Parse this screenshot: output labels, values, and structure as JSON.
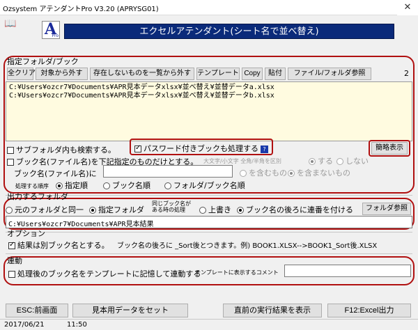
{
  "window": {
    "title": "Ozsystem アテンダントPro V3.20 (APRYSG01)",
    "close": "✕"
  },
  "logo": {
    "letter": "A",
    "sub": "Pro"
  },
  "banner": "エクセルアテンダント(シート名で並べ替え)",
  "folder_section": {
    "heading": "指定フォルダ/ブック",
    "toolbar": [
      "全クリア",
      "対象から外す",
      "存在しないものを一覧から外す",
      "テンプレート",
      "Copy",
      "貼付",
      "ファイル/フォルダ参照"
    ],
    "count": "2",
    "files": [
      "C:¥Users¥ozcr7¥Documents¥APR見本データxlsx¥並べ替え¥並替データa.xlsx",
      "C:¥Users¥ozcr7¥Documents¥APR見本データxlsx¥並べ替え¥並替データb.xlsx"
    ],
    "subfolder_label": "サブフォルダ内も検索する。",
    "password_label": "パスワード付きブックも処理する",
    "help": "?",
    "simple_view": "簡略表示",
    "bookname_filter_label": "ブック名(ファイル名)を下記指定のものだけとする。",
    "case_label": "大文字/小文字 全角/半角を区別",
    "case_yes": "する",
    "case_no": "しない",
    "bookname_in_label": "ブック名(ファイル名)に",
    "contain": "を含むもの",
    "not_contain": "を含まないもの",
    "order_label": "処理する順序",
    "order_options": [
      "指定順",
      "ブック名順",
      "フォルダ/ブック名順"
    ]
  },
  "output_section": {
    "heading": "出力するフォルダ",
    "same_folder": "元のフォルダと同一",
    "specified_folder": "指定フォルダ",
    "same_name_label_1": "同じブック名が",
    "same_name_label_2": "ある時の処理",
    "overwrite": "上書き",
    "append_number": "ブック名の後ろに連番を付ける",
    "browse": "フォルダ参照",
    "path": "C:¥Users¥ozcr7¥Documents¥APR見本結果"
  },
  "options_section": {
    "heading": "オプション",
    "separate_label": "結果は別ブック名とする。",
    "note": "ブック名の後ろに _Sort後とつきます。例) BOOK1.XLSX-->BOOK1_Sort後.XLSX"
  },
  "link_section": {
    "heading": "連動",
    "remember_label": "処理後のブック名をテンプレートに記憶して連動する",
    "comment_label": "テンプレートに表示するコメント"
  },
  "footer": {
    "esc": "ESC:前画面",
    "sample": "見本用データをセット",
    "last_result": "直前の実行結果を表示",
    "f12": "F12:Excel出力"
  },
  "status": {
    "date": "2017/06/21",
    "time": "11:50"
  },
  "colors": {
    "banner": "#0a2a7a",
    "highlight": "#b01010",
    "list_bg": "#fffbe0"
  }
}
